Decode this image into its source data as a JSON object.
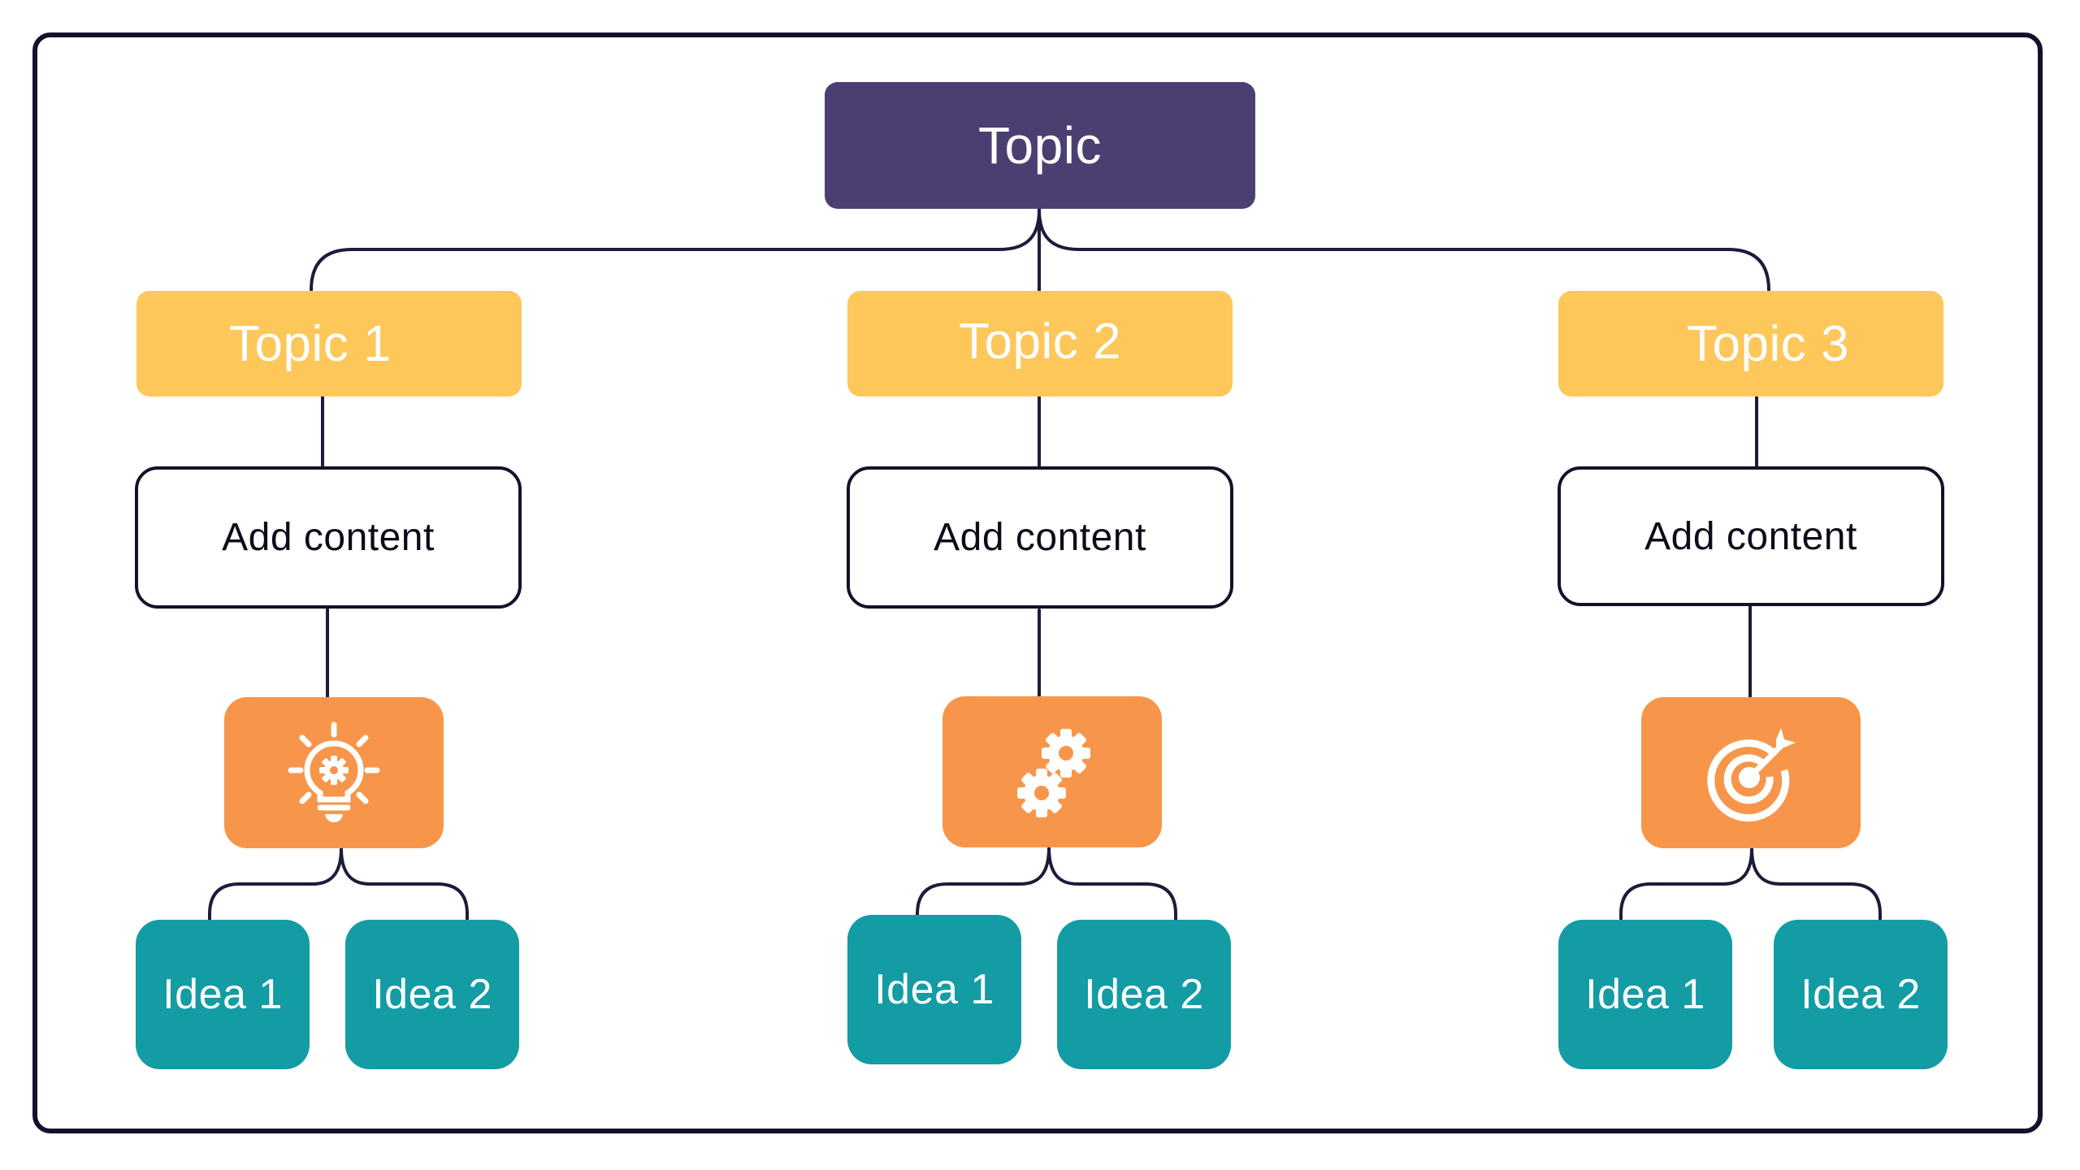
{
  "diagram": {
    "root": {
      "label": "Topic"
    },
    "branches": [
      {
        "topic": "Topic 1",
        "content": "Add content",
        "icon": "lightbulb-icon",
        "ideas": [
          "Idea 1",
          "Idea 2"
        ]
      },
      {
        "topic": "Topic 2",
        "content": "Add content",
        "icon": "gears-icon",
        "ideas": [
          "Idea 1",
          "Idea 2"
        ]
      },
      {
        "topic": "Topic 3",
        "content": "Add content",
        "icon": "target-icon",
        "ideas": [
          "Idea 1",
          "Idea 2"
        ]
      }
    ]
  },
  "colors": {
    "root": "#4b3f72",
    "topic": "#fdc75a",
    "icon_box": "#f7964a",
    "idea": "#149ca4",
    "line": "#1e1b3a",
    "frame": "#14122a"
  }
}
